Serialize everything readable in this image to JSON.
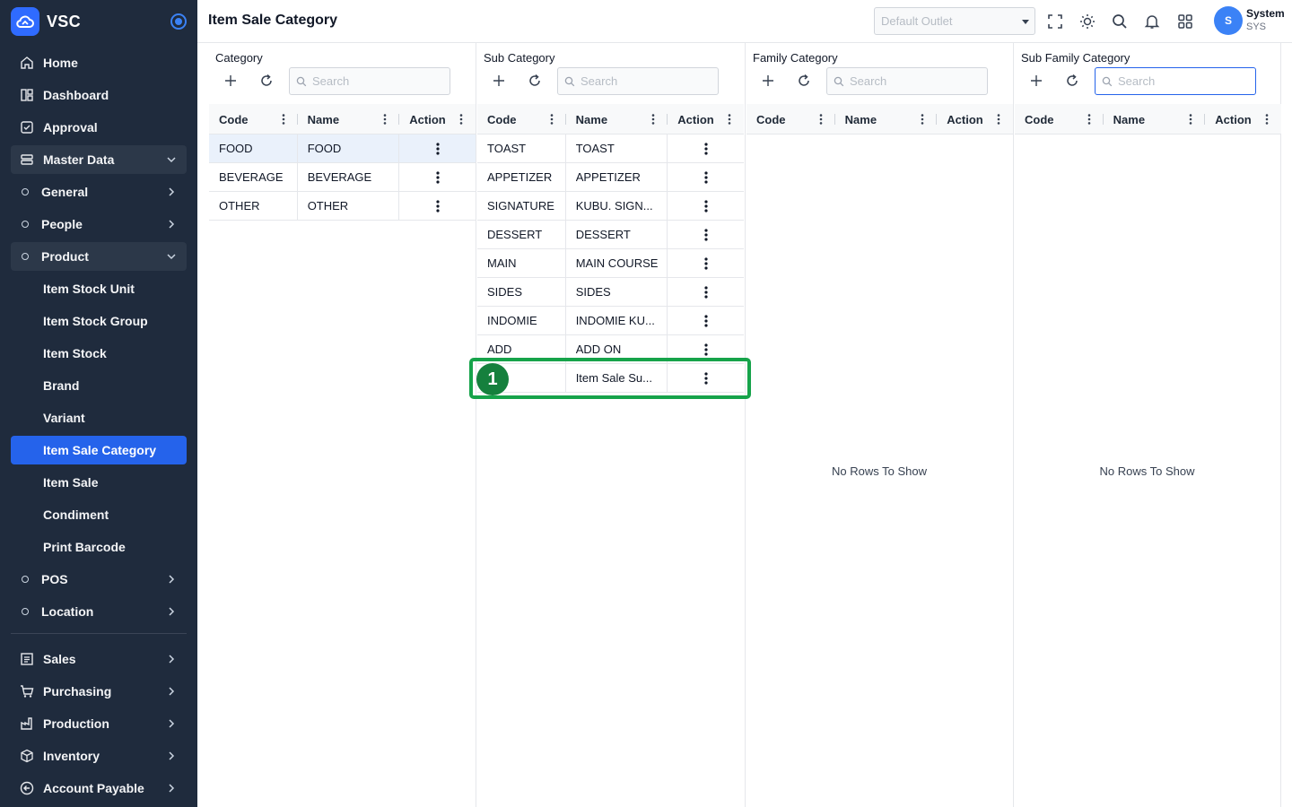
{
  "app": {
    "name": "VSC"
  },
  "sidebar": {
    "items": [
      {
        "key": "home",
        "label": "Home"
      },
      {
        "key": "dashboard",
        "label": "Dashboard"
      },
      {
        "key": "approval",
        "label": "Approval"
      },
      {
        "key": "master-data",
        "label": "Master Data"
      },
      {
        "key": "general",
        "label": "General"
      },
      {
        "key": "people",
        "label": "People"
      },
      {
        "key": "product",
        "label": "Product"
      },
      {
        "key": "item-stock-unit",
        "label": "Item Stock Unit"
      },
      {
        "key": "item-stock-group",
        "label": "Item Stock Group"
      },
      {
        "key": "item-stock",
        "label": "Item Stock"
      },
      {
        "key": "brand",
        "label": "Brand"
      },
      {
        "key": "variant",
        "label": "Variant"
      },
      {
        "key": "item-sale-category",
        "label": "Item Sale Category"
      },
      {
        "key": "item-sale",
        "label": "Item Sale"
      },
      {
        "key": "condiment",
        "label": "Condiment"
      },
      {
        "key": "print-barcode",
        "label": "Print Barcode"
      },
      {
        "key": "pos",
        "label": "POS"
      },
      {
        "key": "location",
        "label": "Location"
      },
      {
        "key": "sales",
        "label": "Sales"
      },
      {
        "key": "purchasing",
        "label": "Purchasing"
      },
      {
        "key": "production",
        "label": "Production"
      },
      {
        "key": "inventory",
        "label": "Inventory"
      },
      {
        "key": "account-payable",
        "label": "Account Payable"
      }
    ]
  },
  "header": {
    "title": "Item Sale Category",
    "outlet_placeholder": "Default Outlet",
    "user": {
      "initial": "S",
      "name": "System",
      "code": "SYS"
    }
  },
  "panels": [
    {
      "title": "Category",
      "search_placeholder": "Search",
      "columns": {
        "code": "Code",
        "name": "Name",
        "action": "Action"
      },
      "rows": [
        {
          "code": "FOOD",
          "name": "FOOD"
        },
        {
          "code": "BEVERAGE",
          "name": "BEVERAGE"
        },
        {
          "code": "OTHER",
          "name": "OTHER"
        }
      ],
      "selected_row": 0,
      "empty_text": ""
    },
    {
      "title": "Sub Category",
      "search_placeholder": "Search",
      "columns": {
        "code": "Code",
        "name": "Name",
        "action": "Action"
      },
      "rows": [
        {
          "code": "TOAST",
          "name": "TOAST"
        },
        {
          "code": "APPETIZER",
          "name": "APPETIZER"
        },
        {
          "code": "SIGNATURE",
          "name": "KUBU. SIGN..."
        },
        {
          "code": "DESSERT",
          "name": "DESSERT"
        },
        {
          "code": "MAIN",
          "name": "MAIN COURSE"
        },
        {
          "code": "SIDES",
          "name": "SIDES"
        },
        {
          "code": "INDOMIE",
          "name": "INDOMIE KU..."
        },
        {
          "code": "ADD",
          "name": "ADD ON"
        },
        {
          "code": "",
          "name": "Item Sale Su..."
        }
      ],
      "selected_row": -1,
      "empty_text": ""
    },
    {
      "title": "Family Category",
      "search_placeholder": "Search",
      "columns": {
        "code": "Code",
        "name": "Name",
        "action": "Action"
      },
      "rows": [],
      "selected_row": -1,
      "empty_text": "No Rows To Show"
    },
    {
      "title": "Sub Family Category",
      "search_placeholder": "Search",
      "columns": {
        "code": "Code",
        "name": "Name",
        "action": "Action"
      },
      "rows": [],
      "selected_row": -1,
      "empty_text": "No Rows To Show"
    }
  ],
  "annotation": {
    "marker_label": "1",
    "color": "#16a34a"
  },
  "colors": {
    "sidebar_bg": "#1f2b3d",
    "accent": "#2563eb",
    "selected_row": "#eaf1fb"
  }
}
